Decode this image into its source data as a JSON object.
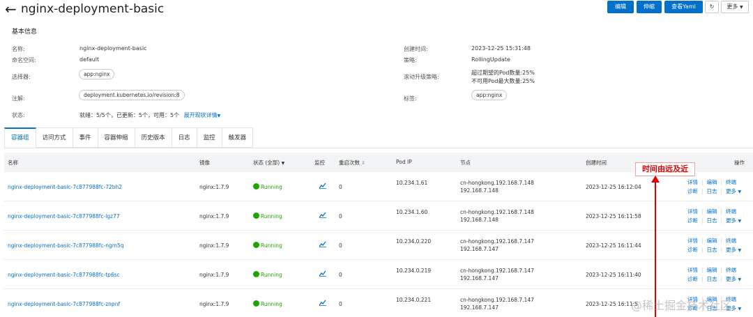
{
  "header": {
    "title": "nginx-deployment-basic",
    "buttons": {
      "edit": "编辑",
      "scale": "伸缩",
      "view_yaml": "查看Yaml",
      "more": "更多"
    }
  },
  "basic_info": {
    "section_title": "基本信息",
    "name_label": "名称:",
    "name_value": "nginx-deployment-basic",
    "namespace_label": "命名空间:",
    "namespace_value": "default",
    "selector_label": "选择器:",
    "selector_value": "app:nginx",
    "annotation_label": "注解:",
    "annotation_value": "deployment.kubernetes.io/revision:8",
    "status_label": "状态:",
    "status_value": "就绪：5/5个，已更新：5个，可用：5个",
    "expand_status": "展开现状详情",
    "created_label": "创建时间:",
    "created_value": "2023-12-25 15:31:48",
    "strategy_label": "策略:",
    "strategy_value": "RollingUpdate",
    "rolling_label": "滚动升级策略:",
    "rolling_value_1": "超过期望的Pod数量:25%",
    "rolling_value_2": "不可用Pod最大数量:25%",
    "labels_label": "标签:",
    "labels_value": "app:nginx"
  },
  "tabs": [
    "容器组",
    "访问方式",
    "事件",
    "容器伸缩",
    "历史版本",
    "日志",
    "监控",
    "触发器"
  ],
  "table": {
    "headers": {
      "name": "名称",
      "image": "镜像",
      "status": "状态 (全部)",
      "monitor": "监控",
      "restarts": "重启次数",
      "pod_ip": "Pod IP",
      "node": "节点",
      "created": "创建时间",
      "actions": "操作"
    },
    "rows": [
      {
        "name": "nginx-deployment-basic-7c877988fc-72bh2",
        "image": "nginx:1.7.9",
        "status": "Running",
        "restarts": "0",
        "pod_ip": "10.234.1.61",
        "node": "cn-hongkong.192.168.7.148",
        "node_ip": "192.168.7.148",
        "created": "2023-12-25 16:12:04"
      },
      {
        "name": "nginx-deployment-basic-7c877988fc-lgz77",
        "image": "nginx:1.7.9",
        "status": "Running",
        "restarts": "0",
        "pod_ip": "10.234.1.60",
        "node": "cn-hongkong.192.168.7.148",
        "node_ip": "192.168.7.148",
        "created": "2023-12-25 16:11:58"
      },
      {
        "name": "nginx-deployment-basic-7c877988fc-ngm5q",
        "image": "nginx:1.7.9",
        "status": "Running",
        "restarts": "0",
        "pod_ip": "10.234.0.220",
        "node": "cn-hongkong.192.168.7.147",
        "node_ip": "192.168.7.147",
        "created": "2023-12-25 16:11:44"
      },
      {
        "name": "nginx-deployment-basic-7c877988fc-tp6sc",
        "image": "nginx:1.7.9",
        "status": "Running",
        "restarts": "0",
        "pod_ip": "10.234.0.219",
        "node": "cn-hongkong.192.168.7.147",
        "node_ip": "192.168.7.147",
        "created": "2023-12-25 16:11:40"
      },
      {
        "name": "nginx-deployment-basic-7c877988fc-znpnf",
        "image": "nginx:1.7.9",
        "status": "Running",
        "restarts": "0",
        "pod_ip": "10.234.0.221",
        "node": "cn-hongkong.192.168.7.147",
        "node_ip": "192.168.7.147",
        "created": "2023-12-25 16:11:5"
      }
    ],
    "actions": {
      "details": "详情",
      "edit": "编辑",
      "terminal": "终端",
      "diagnose": "诊断",
      "logs": "日志",
      "more": "更多"
    }
  },
  "annotation": {
    "text": "时间由远及近"
  },
  "watermark": "@稀土掘金技术社区",
  "colors": {
    "primary": "#0070cc",
    "running": "#1fa400",
    "annotation": "#e00000"
  }
}
